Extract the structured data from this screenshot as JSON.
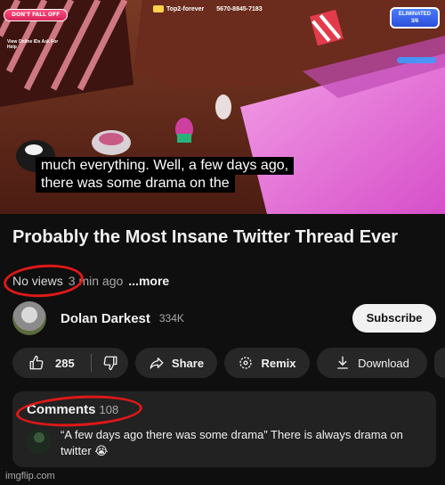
{
  "video": {
    "hud_left_pill": "DON'T FALL OFF",
    "hud_left_small": "View Online IDs Ask For Help",
    "hud_player": "Top2-forever",
    "hud_code": "5670-8845-7183",
    "hud_eliminated_label": "ELIMINATED",
    "hud_eliminated_count": "3/6",
    "caption_line_1": "much everything. Well, a few days ago,",
    "caption_line_2": "there was some drama on the"
  },
  "video_info": {
    "title": "Probably the Most Insane Twitter Thread Ever",
    "views": "No views",
    "time_ago": "3 min ago",
    "more": "...more"
  },
  "channel": {
    "name": "Dolan Darkest",
    "subscribers": "334K",
    "subscribe_label": "Subscribe"
  },
  "actions": {
    "like_count": "285",
    "share_label": "Share",
    "remix_label": "Remix",
    "download_label": "Download"
  },
  "comments": {
    "label": "Comments",
    "count": "108",
    "top_comment": "“A few days ago there was some drama” There is always drama on twitter 😭"
  },
  "watermark": "imgflip.com",
  "colors": {
    "background": "#0f0f0f",
    "button_bg": "#272727",
    "annotation_red": "#e01818"
  }
}
